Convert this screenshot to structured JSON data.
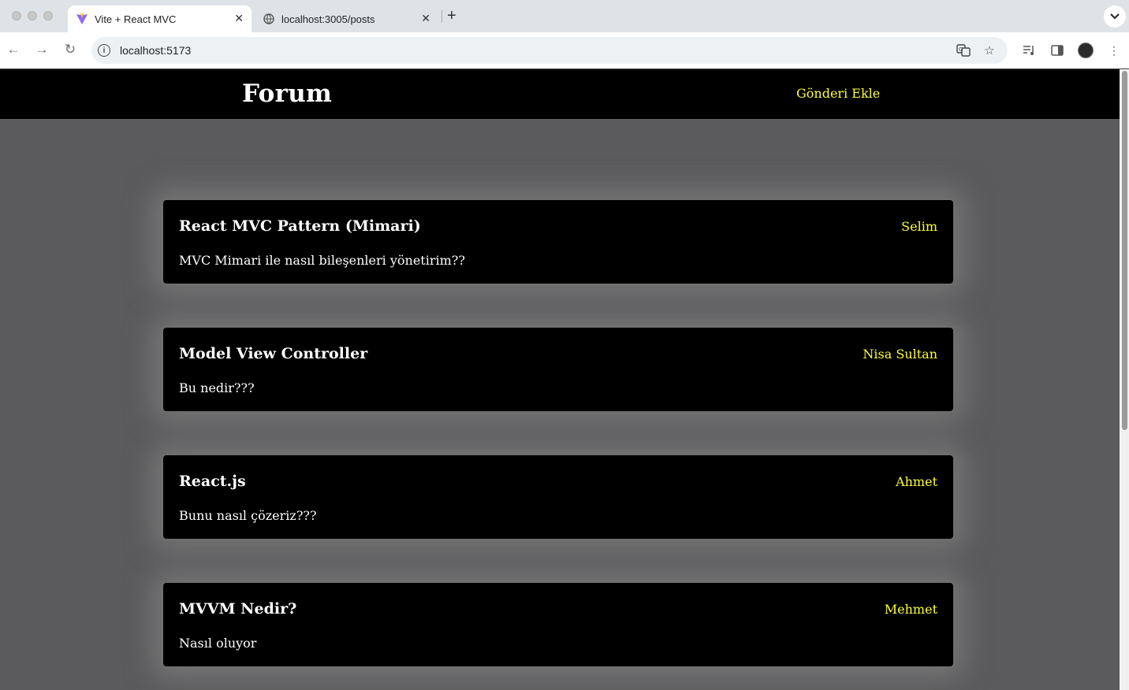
{
  "browser": {
    "tabs": [
      {
        "label": "Vite + React MVC",
        "active": true
      },
      {
        "label": "localhost:3005/posts",
        "active": false
      }
    ],
    "address": "localhost:5173"
  },
  "nav": {
    "brand": "Forum",
    "add_post": "Gönderi Ekle"
  },
  "posts": [
    {
      "title": "React MVC Pattern (Mimari)",
      "author": "Selim",
      "body": "MVC Mimari ile nasıl bileşenleri yönetirim??"
    },
    {
      "title": "Model View Controller",
      "author": "Nisa Sultan",
      "body": "Bu nedir???"
    },
    {
      "title": "React.js",
      "author": "Ahmet",
      "body": "Bunu nasıl çözeriz???"
    },
    {
      "title": "MVVM Nedir?",
      "author": "Mehmet",
      "body": "Nasıl oluyor"
    }
  ],
  "colors": {
    "accent": "#ffff33",
    "nav_bg": "#000000",
    "page_bg": "#5b5b5d"
  }
}
